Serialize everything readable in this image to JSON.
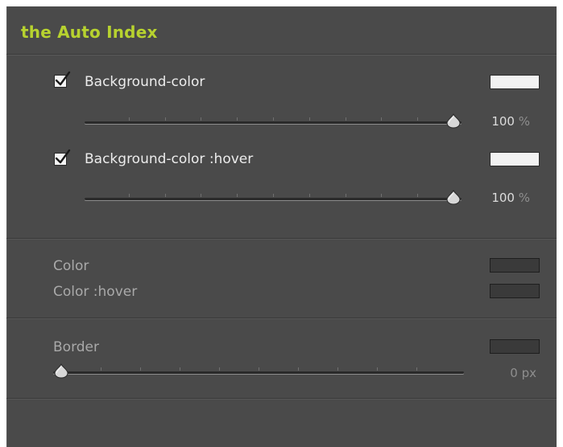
{
  "panel": {
    "title": "the Auto Index"
  },
  "background": {
    "checked": true,
    "label": "Background-color",
    "swatch_color": "#f2f2f2",
    "opacity": {
      "value": "100",
      "unit": "%",
      "fraction": 1.0
    }
  },
  "background_hover": {
    "checked": true,
    "label": "Background-color :hover",
    "swatch_color": "#f2f2f2",
    "opacity": {
      "value": "100",
      "unit": "%",
      "fraction": 1.0
    }
  },
  "text_color": {
    "label": "Color",
    "swatch_color": "#3a3a3a"
  },
  "text_color_hover": {
    "label": "Color :hover",
    "swatch_color": "#3a3a3a"
  },
  "border": {
    "label": "Border",
    "swatch_color": "#3a3a3a",
    "width": {
      "value": "0",
      "unit": "px",
      "fraction": 0.0
    }
  },
  "colors": {
    "title_accent": "#b7d22f",
    "panel_bg": "#4a4a4a"
  }
}
